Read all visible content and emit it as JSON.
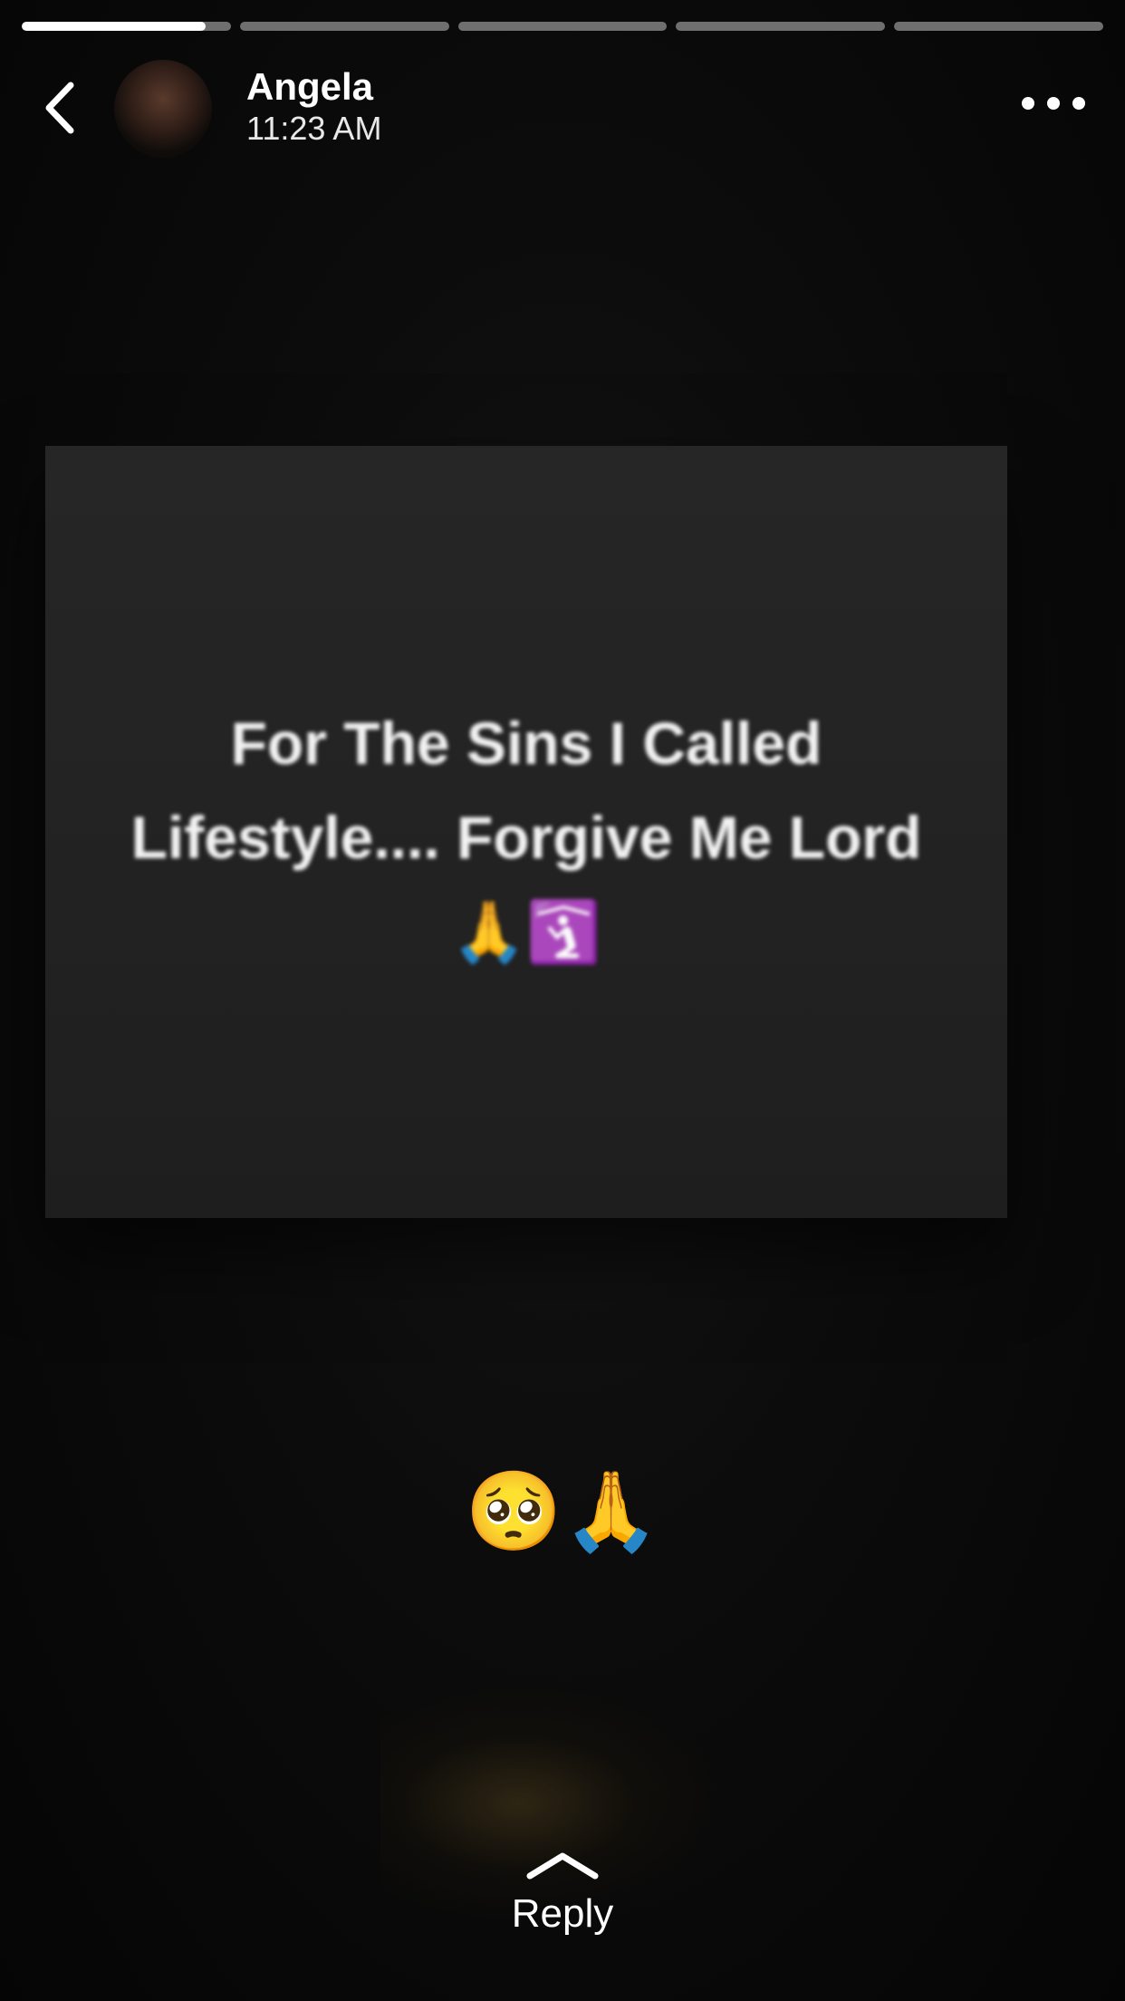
{
  "progress": {
    "segments": 5,
    "current_index": 0,
    "current_fraction": 0.88
  },
  "header": {
    "user_name": "Angela",
    "timestamp": "11:23 AM",
    "back_icon": "chevron-left-icon",
    "more_icon": "more-horizontal-icon"
  },
  "story": {
    "text": "For The Sins I Called Lifestyle.... Forgive Me Lord 🙏🛐",
    "caption": "🥺🙏"
  },
  "footer": {
    "reply_label": "Reply",
    "reply_icon": "chevron-up-icon"
  },
  "colors": {
    "background": "#000000",
    "card": "#242424",
    "progress_inactive": "#6f6f6f",
    "progress_active": "#ffffff"
  }
}
